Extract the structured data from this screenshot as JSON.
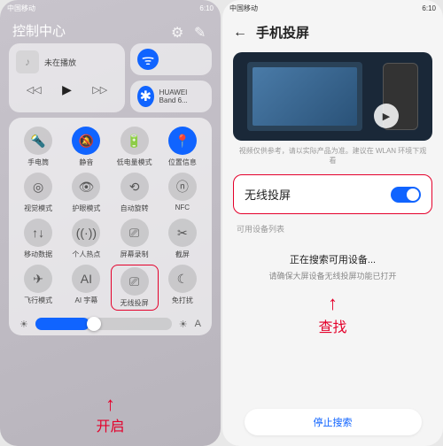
{
  "status": {
    "carrier": "中国移动",
    "time": "6:10"
  },
  "left": {
    "title": "控制中心",
    "music": {
      "nowPlaying": "未在播放",
      "prev": "◁◁",
      "play": "▶",
      "next": "▷▷",
      "album": "♪"
    },
    "wifi": {
      "icon": "ᯤ"
    },
    "bt": {
      "icon": "✱",
      "label": "HUAWEI Band 6..."
    },
    "tiles": [
      {
        "icon": "🔦",
        "label": "手电筒",
        "on": false
      },
      {
        "icon": "🔕",
        "label": "静音",
        "on": true
      },
      {
        "icon": "🔋",
        "label": "低电量模式",
        "on": false
      },
      {
        "icon": "📍",
        "label": "位置信息",
        "on": true
      },
      {
        "icon": "◎",
        "label": "视觉模式",
        "on": false
      },
      {
        "icon": "👁",
        "label": "护眼模式",
        "on": false
      },
      {
        "icon": "⟲",
        "label": "自动旋转",
        "on": false
      },
      {
        "icon": "ⓝ",
        "label": "NFC",
        "on": false
      },
      {
        "icon": "↑↓",
        "label": "移动数据",
        "on": false
      },
      {
        "icon": "((·))",
        "label": "个人热点",
        "on": false
      },
      {
        "icon": "⎚",
        "label": "屏幕录制",
        "on": false
      },
      {
        "icon": "✂",
        "label": "截屏",
        "on": false
      },
      {
        "icon": "✈",
        "label": "飞行模式",
        "on": false
      },
      {
        "icon": "AI",
        "label": "AI 字幕",
        "on": false
      },
      {
        "icon": "⎚",
        "label": "无线投屏",
        "on": false,
        "hl": true
      },
      {
        "icon": "☾",
        "label": "免打扰",
        "on": false
      }
    ],
    "brightness": {
      "low": "☀",
      "high": "☀",
      "auto": "A"
    },
    "anno": "开启"
  },
  "right": {
    "title": "手机投屏",
    "note": "视频仅供参考，请以实际产品为准。建议在 WLAN 环境下观看",
    "toggle": "无线投屏",
    "avail": "可用设备列表",
    "searching": "正在搜索可用设备...",
    "searchSub": "请确保大屏设备无线投屏功能已打开",
    "stop": "停止搜索",
    "anno": "查找"
  }
}
